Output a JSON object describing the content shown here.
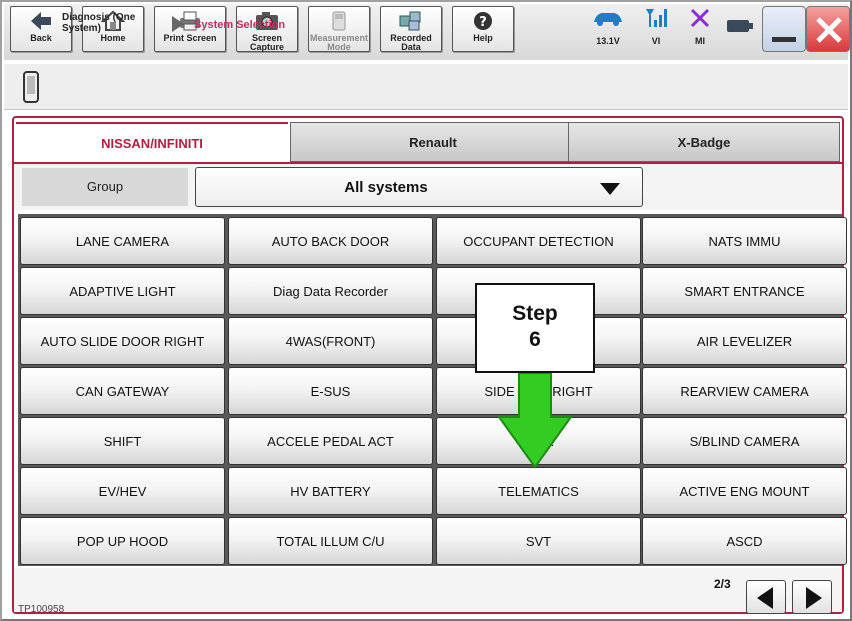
{
  "toolbar": {
    "back": "Back",
    "home": "Home",
    "print_screen": "Print Screen",
    "screen_capture": "Screen Capture",
    "measurement_mode": "Measurement Mode",
    "recorded_data": "Recorded Data",
    "help": "Help"
  },
  "status": {
    "voltage": "13.1V",
    "vi": "VI",
    "mi": "MI"
  },
  "breadcrumb": {
    "item1": "Diagnosis (One System)",
    "item2": "System Selection"
  },
  "tabs": [
    {
      "label": "NISSAN/INFINITI"
    },
    {
      "label": "Renault"
    },
    {
      "label": "X-Badge"
    }
  ],
  "group": {
    "label": "Group",
    "selected": "All systems"
  },
  "systems": [
    [
      "LANE CAMERA",
      "AUTO BACK DOOR",
      "OCCUPANT DETECTION",
      "NATS IMMU"
    ],
    [
      "ADAPTIVE LIGHT",
      "Diag Data Recorder",
      "",
      "SMART ENTRANCE"
    ],
    [
      "AUTO SLIDE DOOR RIGHT",
      "4WAS(FRONT)",
      "T",
      "AIR LEVELIZER"
    ],
    [
      "CAN GATEWAY",
      "E-SUS",
      "SIDE RA  R RIGHT",
      "REARVIEW CAMERA"
    ],
    [
      "SHIFT",
      "ACCELE PEDAL ACT",
      "C      ER",
      "S/BLIND CAMERA"
    ],
    [
      "EV/HEV",
      "HV BATTERY",
      "TELEMATICS",
      "ACTIVE ENG MOUNT"
    ],
    [
      "POP UP HOOD",
      "TOTAL ILLUM C/U",
      "SVT",
      "ASCD"
    ]
  ],
  "pagination": {
    "page": "2/3"
  },
  "footer_code": "TP100958",
  "callout": {
    "line1": "Step",
    "line2": "6"
  },
  "colors": {
    "accent": "#b02040",
    "arrow_green": "#33cc22"
  }
}
